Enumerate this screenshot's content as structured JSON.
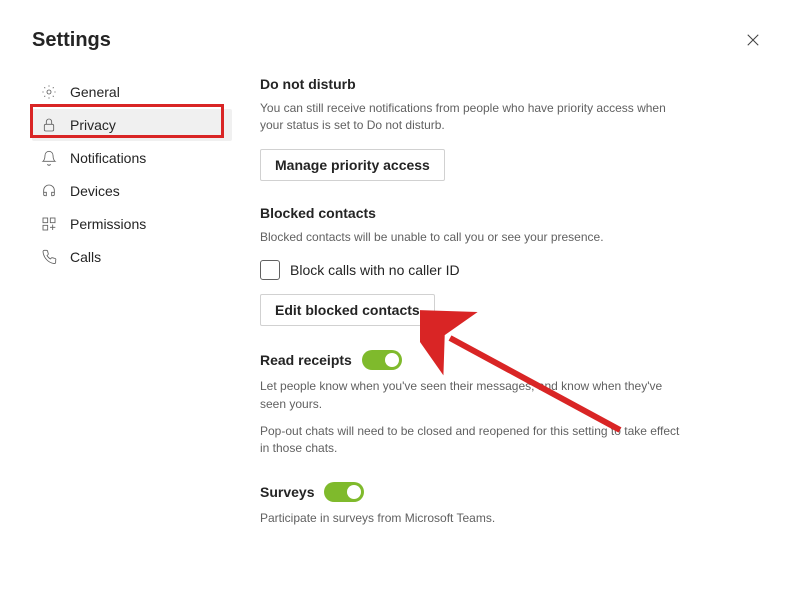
{
  "header": {
    "title": "Settings"
  },
  "sidebar": {
    "items": [
      {
        "label": "General"
      },
      {
        "label": "Privacy"
      },
      {
        "label": "Notifications"
      },
      {
        "label": "Devices"
      },
      {
        "label": "Permissions"
      },
      {
        "label": "Calls"
      }
    ]
  },
  "content": {
    "dnd": {
      "title": "Do not disturb",
      "desc": "You can still receive notifications from people who have priority access when your status is set to Do not disturb.",
      "button": "Manage priority access"
    },
    "blocked": {
      "title": "Blocked contacts",
      "desc": "Blocked contacts will be unable to call you or see your presence.",
      "checkbox": "Block calls with no caller ID",
      "button": "Edit blocked contacts"
    },
    "receipts": {
      "title": "Read receipts",
      "desc1": "Let people know when you've seen their messages, and know when they've seen yours.",
      "desc2": "Pop-out chats will need to be closed and reopened for this setting to take effect in those chats."
    },
    "surveys": {
      "title": "Surveys",
      "desc": "Participate in surveys from Microsoft Teams."
    }
  }
}
